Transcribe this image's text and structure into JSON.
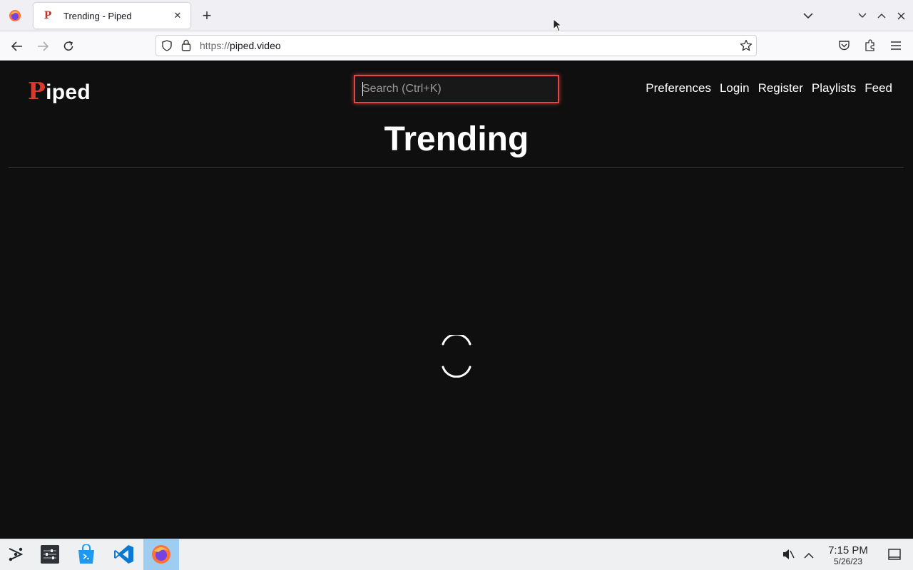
{
  "browser": {
    "tab_title": "Trending - Piped",
    "tab_favicon_letter": "P",
    "new_tab_symbol": "+",
    "tab_close_symbol": "✕",
    "url_scheme": "https://",
    "url_host": "piped.video"
  },
  "page": {
    "logo_first": "P",
    "logo_rest": "iped",
    "search_placeholder": "Search (Ctrl+K)",
    "nav": [
      "Preferences",
      "Login",
      "Register",
      "Playlists",
      "Feed"
    ],
    "heading": "Trending",
    "accent_color": "#e04a42"
  },
  "taskbar": {
    "time": "7:15 PM",
    "date": "5/26/23",
    "apps": [
      "launcher-icon",
      "settings-icon",
      "store-icon",
      "vscode-icon",
      "firefox-icon"
    ]
  }
}
